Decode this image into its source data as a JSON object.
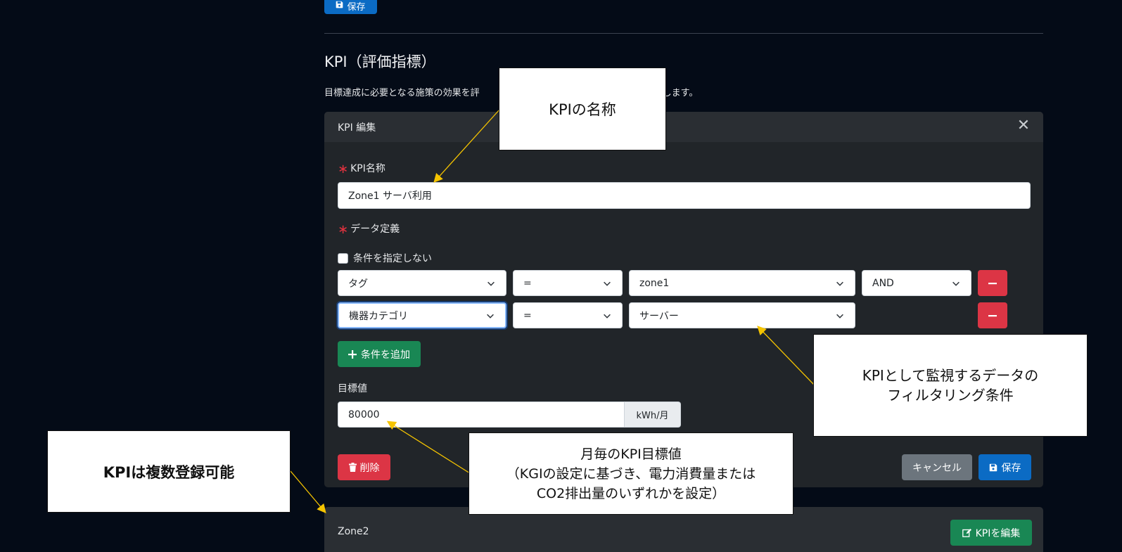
{
  "top_save_label": "保存",
  "section": {
    "title": "KPI（評価指標）",
    "description": "目標達成に必要となる施策の効果を評",
    "description_tail": "します。"
  },
  "editor": {
    "header_title": "KPI 編集",
    "kpi_name_label": "KPI名称",
    "kpi_name_value": "Zone1 サーバ利用",
    "data_def_label": "データ定義",
    "no_condition_label": "条件を指定しない",
    "conditions": [
      {
        "field": "タグ",
        "operator": "=",
        "value": "zone1",
        "logic": "AND"
      },
      {
        "field": "機器カテゴリ",
        "operator": "=",
        "value": "サーバー"
      }
    ],
    "add_condition_label": "条件を追加",
    "target_label": "目標値",
    "target_value": "80000",
    "target_unit": "kWh/月",
    "delete_label": "削除",
    "cancel_label": "キャンセル",
    "save_label": "保存"
  },
  "zone2": {
    "title": "Zone2",
    "edit_label": "KPIを編集"
  },
  "callouts": {
    "name": "KPIの名称",
    "filter_line1": "KPIとして監視するデータの",
    "filter_line2": "フィルタリング条件",
    "target_line1": "月毎のKPI目標値",
    "target_line2": "（KGIの設定に基づき、電力消費量または",
    "target_line3": "CO2排出量のいずれかを設定）",
    "multi": "KPIは複数登録可能"
  },
  "colors": {
    "background": "#040b17",
    "card": "#212529",
    "primary": "#0b6bc4",
    "success": "#198754",
    "danger": "#dc3545",
    "secondary": "#6c757d",
    "annotation_arrow": "#f5c400"
  }
}
